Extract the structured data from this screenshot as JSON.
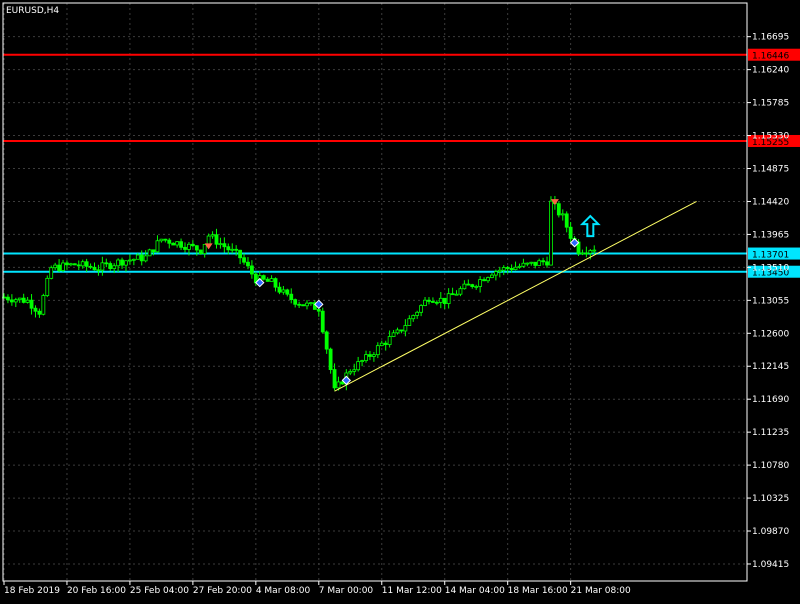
{
  "window": {
    "title": "EURUSD,H4"
  },
  "colors": {
    "background": "#000000",
    "grid": "#3c3c3c",
    "frame": "#ffffff",
    "candle": "#00ff00",
    "resistance": "#ff0000",
    "support": "#00e5ff",
    "trendline": "#ffff66",
    "axis_text": "#ffffff",
    "up_arrow": "#00e5ff"
  },
  "chart_data": {
    "type": "candlestick",
    "symbol": "EURUSD",
    "timeframe": "H4",
    "title": "EURUSD,H4",
    "ylim": [
      1.0918,
      1.1716
    ],
    "y_ticks": [
      "1.16695",
      "1.16240",
      "1.15785",
      "1.15330",
      "1.14875",
      "1.14420",
      "1.13965",
      "1.13510",
      "1.13055",
      "1.12600",
      "1.12145",
      "1.11690",
      "1.11235",
      "1.10780",
      "1.10325",
      "1.09870",
      "1.09415"
    ],
    "x_ticks": [
      "18 Feb 2019",
      "20 Feb 16:00",
      "25 Feb 04:00",
      "27 Feb 20:00",
      "4 Mar 08:00",
      "7 Mar 00:00",
      "11 Mar 12:00",
      "14 Mar 04:00",
      "18 Mar 16:00",
      "21 Mar 08:00"
    ],
    "x_tick_bar_index": [
      0,
      16,
      32,
      48,
      64,
      80,
      96,
      112,
      128,
      144
    ],
    "bar_count": 190,
    "price_path": [
      [
        0,
        1.131
      ],
      [
        6,
        1.1305
      ],
      [
        9,
        1.129
      ],
      [
        12,
        1.135
      ],
      [
        18,
        1.1355
      ],
      [
        24,
        1.135
      ],
      [
        30,
        1.136
      ],
      [
        36,
        1.1365
      ],
      [
        40,
        1.139
      ],
      [
        44,
        1.1385
      ],
      [
        50,
        1.1375
      ],
      [
        52,
        1.1395
      ],
      [
        56,
        1.138
      ],
      [
        60,
        1.1365
      ],
      [
        64,
        1.1335
      ],
      [
        68,
        1.133
      ],
      [
        72,
        1.131
      ],
      [
        76,
        1.13
      ],
      [
        80,
        1.1295
      ],
      [
        82,
        1.124
      ],
      [
        84,
        1.118
      ],
      [
        88,
        1.121
      ],
      [
        92,
        1.1225
      ],
      [
        96,
        1.1245
      ],
      [
        100,
        1.126
      ],
      [
        104,
        1.1285
      ],
      [
        108,
        1.131
      ],
      [
        112,
        1.1305
      ],
      [
        116,
        1.132
      ],
      [
        120,
        1.133
      ],
      [
        124,
        1.1345
      ],
      [
        128,
        1.135
      ],
      [
        134,
        1.1355
      ],
      [
        138,
        1.136
      ],
      [
        139,
        1.144
      ],
      [
        142,
        1.142
      ],
      [
        144,
        1.1395
      ],
      [
        146,
        1.1375
      ],
      [
        150,
        1.1378
      ]
    ],
    "horizontal_lines": [
      {
        "price": 1.16446,
        "label": "1.16446",
        "kind": "resistance"
      },
      {
        "price": 1.15255,
        "label": "1.15255",
        "kind": "resistance"
      },
      {
        "price": 1.13701,
        "label": "1.13701",
        "kind": "support"
      },
      {
        "price": 1.1345,
        "label": "1.13450",
        "kind": "support"
      }
    ],
    "trendline": {
      "from": {
        "bar": 84,
        "price": 1.118
      },
      "to": {
        "bar": 176,
        "price": 1.1442
      }
    },
    "markers": [
      {
        "bar": 52,
        "price": 1.138,
        "type": "sell"
      },
      {
        "bar": 65,
        "price": 1.133,
        "type": "buy"
      },
      {
        "bar": 80,
        "price": 1.13,
        "type": "buy"
      },
      {
        "bar": 87,
        "price": 1.1195,
        "type": "buy"
      },
      {
        "bar": 140,
        "price": 1.1441,
        "type": "sell"
      },
      {
        "bar": 145,
        "price": 1.1385,
        "type": "buy"
      }
    ],
    "up_arrow": {
      "bar": 149,
      "price": 1.1408
    }
  }
}
